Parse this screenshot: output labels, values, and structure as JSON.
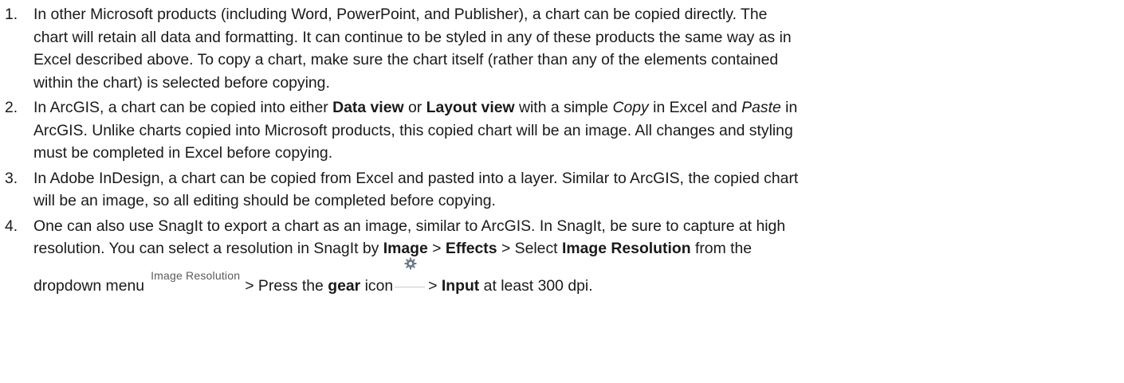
{
  "items": [
    {
      "number": "1.",
      "lines": [
        "In other Microsoft products (including Word, PowerPoint, and Publisher), a chart can be copied directly. The",
        "chart will retain all data and formatting. It can continue to be styled in any of these products the same way as in",
        "Excel described above. To copy a chart, make sure the chart itself (rather than any of the elements contained",
        "within the chart) is selected before copying."
      ]
    },
    {
      "number": "2.",
      "line1": {
        "a": "In ArcGIS, a chart can be copied into either ",
        "b": "Data view",
        "c": " or ",
        "d": "Layout view",
        "e": " with a simple ",
        "f": "Copy",
        "g": " in Excel and ",
        "h": "Paste",
        "i": " in"
      },
      "lines": [
        "ArcGIS. Unlike charts copied into Microsoft products, this copied chart will be an image. All changes and styling",
        "must be completed in Excel before copying."
      ]
    },
    {
      "number": "3.",
      "lines": [
        "In Adobe InDesign, a chart can be copied from Excel and pasted into a layer. Similar to ArcGIS, the copied chart",
        "will be an image, so all editing should be completed before copying."
      ]
    },
    {
      "number": "4.",
      "line1": "One can also use SnagIt to export a chart as an image, similar to ArcGIS. In SnagIt, be sure to capture at high",
      "line2": {
        "a": "resolution. You can select a resolution in SnagIt by ",
        "b": "Image",
        "c": " > ",
        "d": "Effects",
        "e": " > Select ",
        "f": "Image Resolution",
        "g": " from the"
      },
      "line3": {
        "a": "dropdown menu",
        "img_label": "Image Resolution",
        "b": "> Press the ",
        "c": "gear",
        "d": " icon",
        "e": "> ",
        "f": "Input",
        "g": " at least 300 dpi."
      }
    }
  ],
  "icons": {
    "gear": "gear-icon",
    "gear_color": "#6b7b8c"
  }
}
